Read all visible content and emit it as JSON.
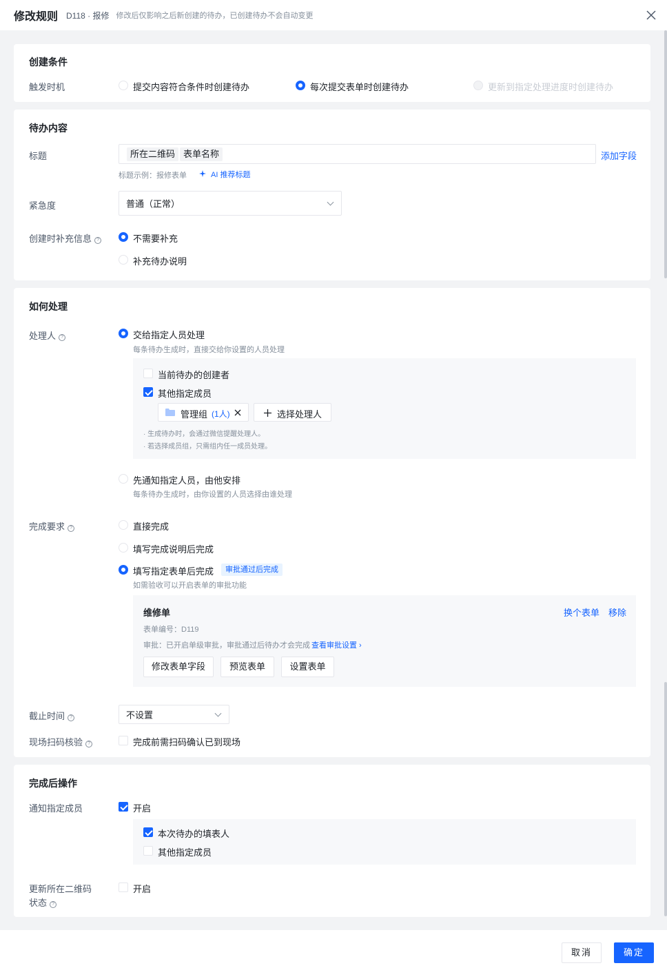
{
  "header": {
    "title": "修改规则",
    "sub": "D118 · 报修",
    "hint": "修改后仅影响之后新创建的待办，已创建待办不会自动变更"
  },
  "create": {
    "title": "创建条件",
    "trigger_label": "触发时机",
    "options": [
      "提交内容符合条件时创建待办",
      "每次提交表单时创建待办",
      "更新到指定处理进度时创建待办"
    ]
  },
  "content": {
    "title": "待办内容",
    "title_label": "标题",
    "title_tags": [
      "所在二维码",
      "表单名称"
    ],
    "add_field": "添加字段",
    "title_example": "标题示例：报修表单",
    "ai_suggest": "AI 推荐标题",
    "urgency_label": "紧急度",
    "urgency_value": "普通（正常）",
    "supplement_label": "创建时补充信息",
    "supplement_options": [
      "不需要补充",
      "补充待办说明"
    ]
  },
  "handle": {
    "title": "如何处理",
    "handler_label": "处理人",
    "opt_assign": "交给指定人员处理",
    "opt_assign_desc": "每条待办生成时，直接交给你设置的人员处理",
    "cb_creator": "当前待办的创建者",
    "cb_others": "其他指定成员",
    "group_name": "管理组",
    "group_count": "(1人)",
    "select_handler": "选择处理人",
    "note1": "· 生成待办时，会通过微信提醒处理人。",
    "note2": "· 若选择成员组，只需组内任一成员处理。",
    "opt_notify": "先通知指定人员，由他安排",
    "opt_notify_desc": "每条待办生成时，由你设置的人员选择由谁处理",
    "complete_label": "完成要求",
    "complete_options": [
      "直接完成",
      "填写完成说明后完成",
      "填写指定表单后完成"
    ],
    "approval_badge": "审批通过后完成",
    "complete_desc": "如需验收可以开启表单的审批功能",
    "form_name": "维修单",
    "change_form": "换个表单",
    "remove": "移除",
    "form_no": "表单编号：D119",
    "approval_text": "审批：已开启单级审批，审批通过后待办才会完成",
    "approval_link": "查看审批设置 ›",
    "buttons": [
      "修改表单字段",
      "预览表单",
      "设置表单"
    ],
    "deadline_label": "截止时间",
    "deadline_value": "不设置",
    "scan_label": "现场扫码核验",
    "scan_option": "完成前需扫码确认已到现场"
  },
  "after": {
    "title": "完成后操作",
    "notify_label": "通知指定成员",
    "enable": "开启",
    "cb_filler": "本次待办的填表人",
    "cb_others": "其他指定成员",
    "update_label_1": "更新所在二维码",
    "update_label_2": "状态",
    "update_enable": "开启"
  },
  "footer": {
    "cancel": "取消",
    "ok": "确定"
  },
  "colors": {
    "accent": "#1664ff",
    "background": "#f2f3f5"
  }
}
